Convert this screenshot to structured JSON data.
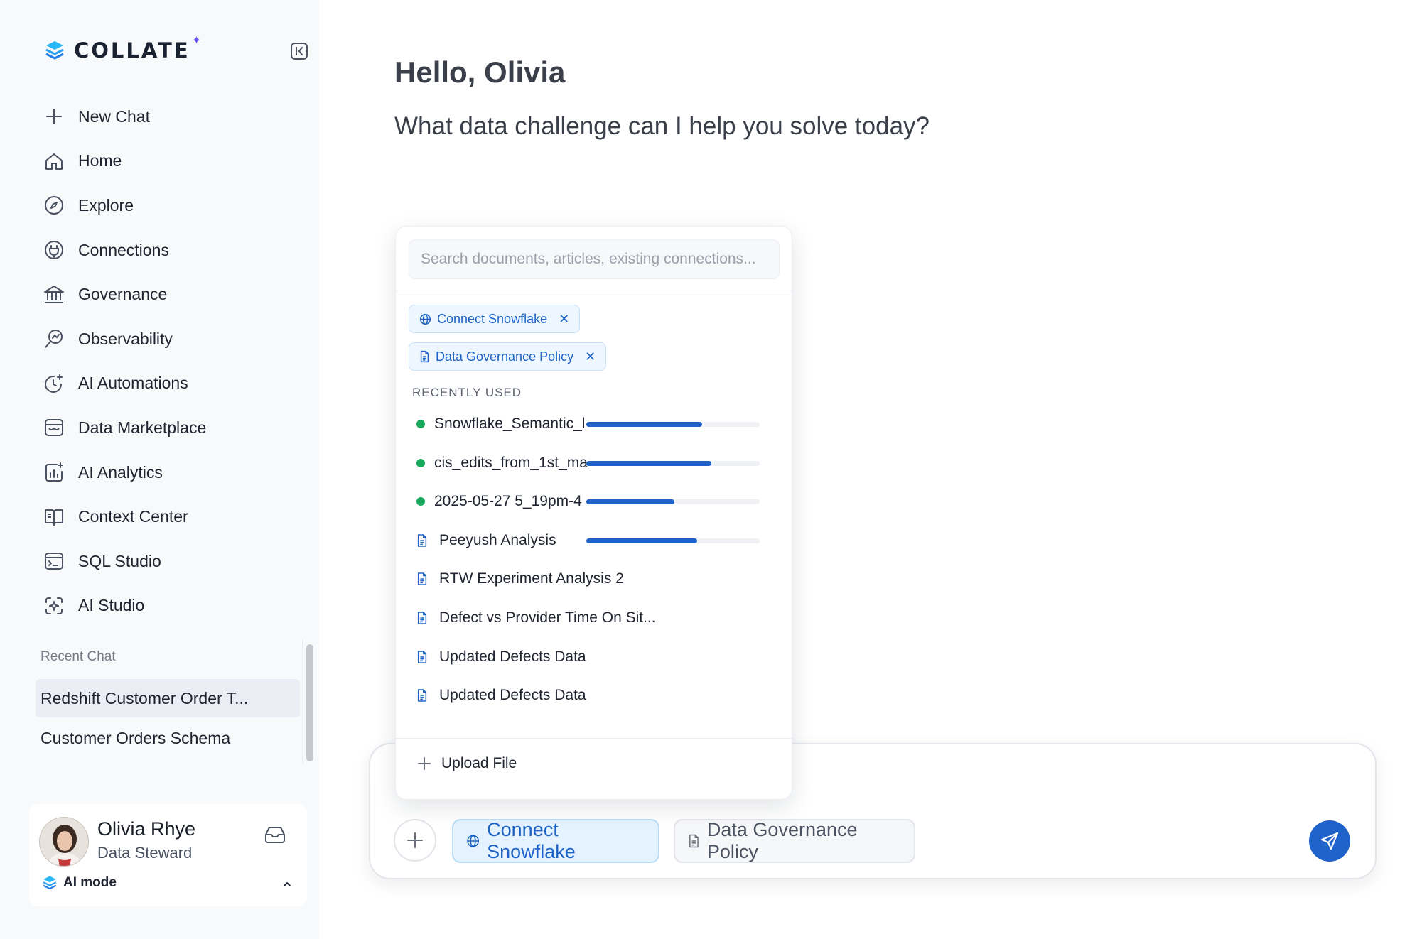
{
  "app": {
    "brand": "COLLATE",
    "accent_color": "#1f62c9",
    "brand_spark_color": "#6e55f5"
  },
  "sidebar": {
    "nav": [
      {
        "label": "New Chat",
        "icon": "plus-icon"
      },
      {
        "label": "Home",
        "icon": "home-icon"
      },
      {
        "label": "Explore",
        "icon": "compass-icon"
      },
      {
        "label": "Connections",
        "icon": "plug-icon"
      },
      {
        "label": "Governance",
        "icon": "bank-icon"
      },
      {
        "label": "Observability",
        "icon": "search-chart-icon"
      },
      {
        "label": "AI Automations",
        "icon": "clock-sparkle-icon"
      },
      {
        "label": "Data Marketplace",
        "icon": "storefront-icon"
      },
      {
        "label": "AI Analytics",
        "icon": "chart-sparkle-icon"
      },
      {
        "label": "Context Center",
        "icon": "book-icon"
      },
      {
        "label": "SQL Studio",
        "icon": "terminal-icon"
      },
      {
        "label": "AI Studio",
        "icon": "ai-sparkle-icon"
      }
    ],
    "recent_title": "Recent Chat",
    "recent": [
      {
        "label": "Redshift Customer Order T...",
        "active": true
      },
      {
        "label": "Customer Orders Schema",
        "active": false
      }
    ],
    "user": {
      "name": "Olivia Rhye",
      "role": "Data Steward",
      "mode_label": "AI mode"
    }
  },
  "main": {
    "greeting": "Hello, Olivia",
    "subtitle": "What data challenge can I help you solve today?"
  },
  "panel": {
    "search_placeholder": "Search documents, articles, existing connections...",
    "search_value": "",
    "selected_tags": [
      {
        "label": "Connect Snowflake",
        "icon": "globe-icon"
      },
      {
        "label": "Data Governance Policy",
        "icon": "document-icon"
      }
    ],
    "section_label": "RECENTLY USED",
    "recent_items": [
      {
        "name": "Snowflake_Semantic_l",
        "kind": "connection",
        "progress": 0.67
      },
      {
        "name": "cis_edits_from_1st_ma",
        "kind": "connection",
        "progress": 0.72
      },
      {
        "name": "2025-05-27 5_19pm-4",
        "kind": "connection",
        "progress": 0.51
      },
      {
        "name": "Peeyush Analysis",
        "kind": "document",
        "progress": 0.64
      },
      {
        "name": "RTW Experiment Analysis 2",
        "kind": "document",
        "progress": null
      },
      {
        "name": "Defect vs Provider Time On Sit...",
        "kind": "document",
        "progress": null
      },
      {
        "name": "Updated Defects Data",
        "kind": "document",
        "progress": null
      },
      {
        "name": "Updated Defects Data",
        "kind": "document",
        "progress": null
      }
    ],
    "upload_label": "Upload File"
  },
  "composer": {
    "chips": [
      {
        "label": "Connect Snowflake",
        "icon": "globe-icon",
        "style": "blue"
      },
      {
        "label": "Data Governance Policy",
        "icon": "document-icon",
        "style": "gray"
      }
    ]
  }
}
